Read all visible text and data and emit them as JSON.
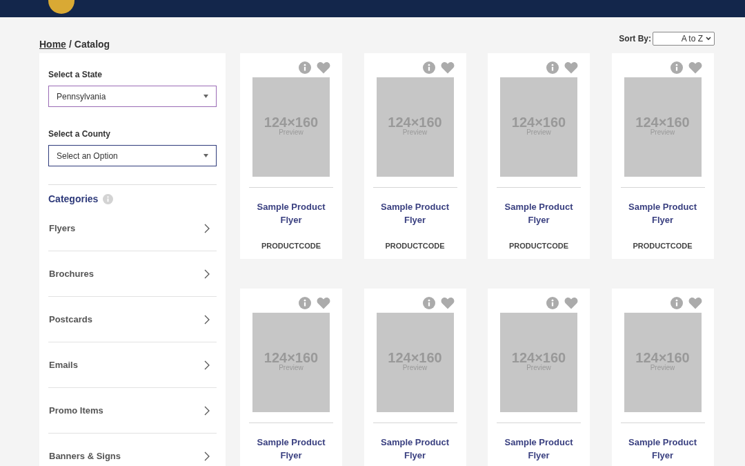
{
  "breadcrumb": {
    "home": "Home",
    "separator": "/",
    "current": "Catalog"
  },
  "sort": {
    "label": "Sort By:",
    "value": "A to Z"
  },
  "filters": [
    {
      "label": "Select a State",
      "value": "Pennsylvania",
      "focused": true
    },
    {
      "label": "Select a County",
      "value": "Select an Option",
      "focused": false
    }
  ],
  "categories": {
    "title": "Categories",
    "items": [
      "Flyers",
      "Brochures",
      "Postcards",
      "Emails",
      "Promo Items",
      "Banners & Signs"
    ]
  },
  "products": [
    {
      "size": "124×160",
      "caption": "Preview",
      "title": "Sample Product Flyer",
      "code": "PRODUCTCODE"
    },
    {
      "size": "124×160",
      "caption": "Preview",
      "title": "Sample Product Flyer",
      "code": "PRODUCTCODE"
    },
    {
      "size": "124×160",
      "caption": "Preview",
      "title": "Sample Product Flyer",
      "code": "PRODUCTCODE"
    },
    {
      "size": "124×160",
      "caption": "Preview",
      "title": "Sample Product Flyer",
      "code": "PRODUCTCODE"
    },
    {
      "size": "124×160",
      "caption": "Preview",
      "title": "Sample Product Flyer"
    },
    {
      "size": "124×160",
      "caption": "Preview",
      "title": "Sample Product Flyer"
    },
    {
      "size": "124×160",
      "caption": "Preview",
      "title": "Sample Product Flyer"
    },
    {
      "size": "124×160",
      "caption": "Preview",
      "title": "Sample Product Flyer"
    }
  ]
}
